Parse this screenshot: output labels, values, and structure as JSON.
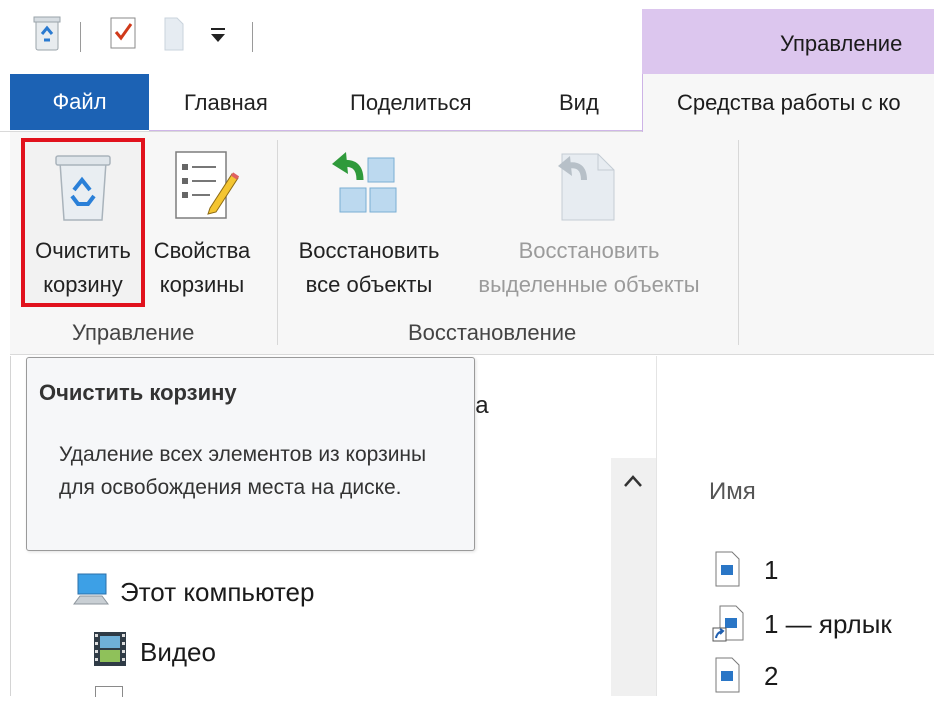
{
  "tabs": {
    "file": "Файл",
    "home": "Главная",
    "share": "Поделиться",
    "view": "Вид",
    "context_header": "Управление",
    "tools": "Средства работы с ко"
  },
  "ribbon": {
    "empty_bin": [
      "Очистить",
      "корзину"
    ],
    "bin_properties": [
      "Свойства",
      "корзины"
    ],
    "restore_all": [
      "Восстановить",
      "все объекты"
    ],
    "restore_selected": [
      "Восстановить",
      "выделенные объекты"
    ],
    "group_manage": "Управление",
    "group_restore": "Восстановление"
  },
  "tooltip": {
    "title": "Очистить корзину",
    "body": "Удаление всех элементов из корзины для освобождения места на диске."
  },
  "background_fragment": "на",
  "nav_tree": [
    {
      "label": "Этот компьютер",
      "icon": "computer-icon"
    },
    {
      "label": "Видео",
      "icon": "video-folder-icon"
    }
  ],
  "file_list": {
    "column_name": "Имя",
    "items": [
      {
        "name": "1",
        "icon": "image-file-icon"
      },
      {
        "name": "1 — ярлык",
        "icon": "shortcut-file-icon"
      },
      {
        "name": "2",
        "icon": "image-file-icon"
      }
    ]
  },
  "colors": {
    "file_tab": "#1c62b4",
    "context_tab": "#dcc6ee",
    "highlight": "#e1121d"
  }
}
